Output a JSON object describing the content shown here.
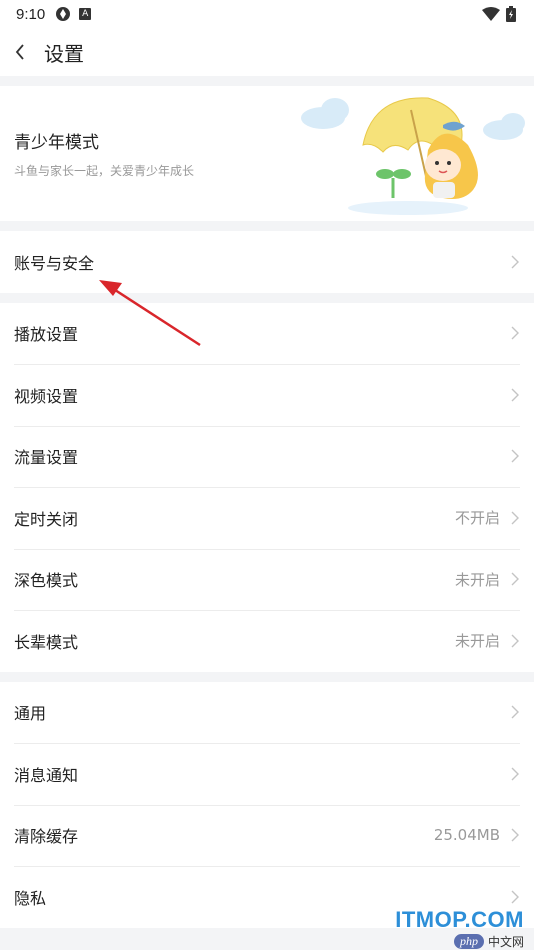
{
  "status_bar": {
    "time": "9:10",
    "a_label": "A"
  },
  "header": {
    "title": "设置"
  },
  "teen": {
    "title": "青少年模式",
    "subtitle": "斗鱼与家长一起，关爱青少年成长"
  },
  "account": {
    "label": "账号与安全"
  },
  "playback_section": {
    "items": [
      {
        "label": "播放设置",
        "value": ""
      },
      {
        "label": "视频设置",
        "value": ""
      },
      {
        "label": "流量设置",
        "value": ""
      },
      {
        "label": "定时关闭",
        "value": "不开启"
      },
      {
        "label": "深色模式",
        "value": "未开启"
      },
      {
        "label": "长辈模式",
        "value": "未开启"
      }
    ]
  },
  "general_section": {
    "items": [
      {
        "label": "通用",
        "value": ""
      },
      {
        "label": "消息通知",
        "value": ""
      },
      {
        "label": "清除缓存",
        "value": "25.04MB"
      },
      {
        "label": "隐私",
        "value": ""
      }
    ]
  },
  "watermark": {
    "main": "ITMOP.COM",
    "php": "php",
    "sub": "中文网"
  },
  "colors": {
    "accent_arrow": "#d9262b",
    "chevron": "#c4c4c4",
    "watermark": "#2d8fd8"
  }
}
